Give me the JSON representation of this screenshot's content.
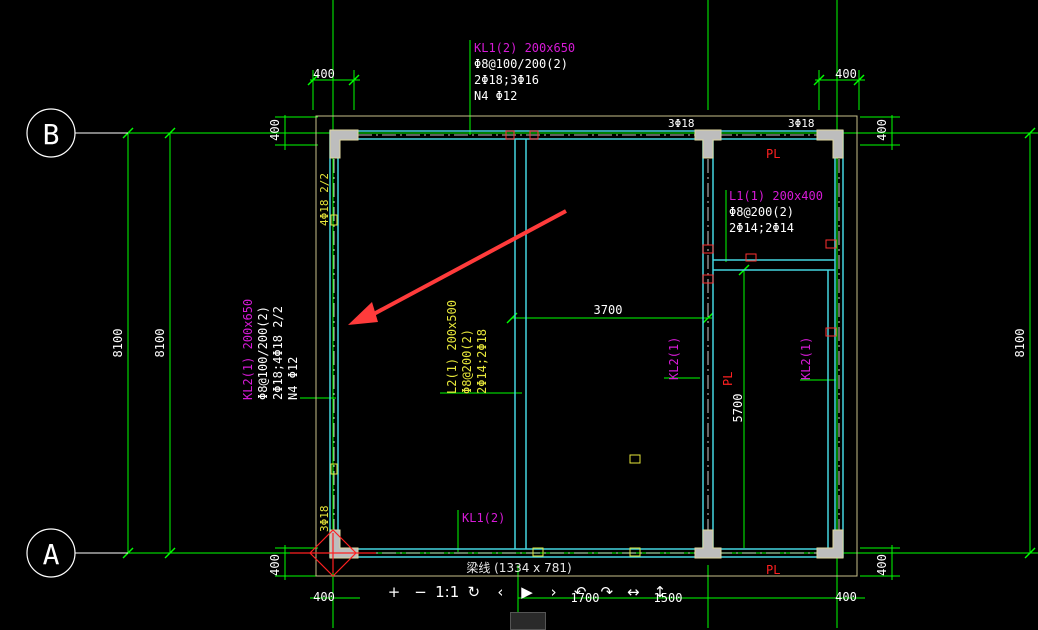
{
  "colors": {
    "background": "#000000",
    "dimension": "#00ff00",
    "wall": "#c8c08a",
    "beam": "#44d6e0",
    "magenta": "#d61ad6",
    "yellow": "#e6e63a",
    "white": "#ffffff",
    "red": "#ff2020",
    "column": "#bdbdbd",
    "arrow": "#ff3b3b"
  },
  "axes": {
    "b": "B",
    "a": "A"
  },
  "dims": {
    "top_left": "400",
    "top_right": "400",
    "bottom_left": "400",
    "bottom_right": "400",
    "left_top": "400",
    "left_bottom": "400",
    "right_top": "400",
    "right_bottom": "400",
    "left_outer": "8100",
    "left_inner": "8100",
    "right_outer": "8100",
    "mid_3700": "3700",
    "mid_5700": "5700",
    "bottom_1700": "1700",
    "bottom_1500": "1500"
  },
  "labels": {
    "kl1_top": [
      "KL1(2) 200x650",
      "Φ8@100/200(2)",
      "2Φ18;3Φ16",
      "N4 Φ12"
    ],
    "top_rebar_1": "3Φ18",
    "top_rebar_2": "3Φ18",
    "pl_top": "PL",
    "l1": [
      "L1(1) 200x400",
      "Φ8@200(2)",
      "2Φ14;2Φ14"
    ],
    "kl2_left": [
      "KL2(1) 200x650",
      "Φ8@100/200(2)",
      "2Φ18;4Φ18 2/2",
      "N4 Φ12"
    ],
    "left_rebar_top": "4Φ18 2/2",
    "left_rebar_bottom": "3Φ18",
    "l2": [
      "L2(1) 200x500",
      "Φ8@200(2)",
      "2Φ14;2Φ18"
    ],
    "kl2_mid": "KL2(1)",
    "kl2_right": "KL2(1)",
    "pl_mid": "PL",
    "pl_bottom": "PL",
    "kl1_bottom": "KL1(2)"
  },
  "viewer": {
    "caption": "梁线 (1334 x 781)",
    "zoom_in": "+",
    "zoom_out": "−",
    "actual_size": "1:1",
    "reset": "↻",
    "prev": "‹",
    "play": "▶",
    "next": "›",
    "rotate_left": "↶",
    "rotate_right": "↷",
    "flip_h": "↔",
    "flip_v": "↕"
  }
}
